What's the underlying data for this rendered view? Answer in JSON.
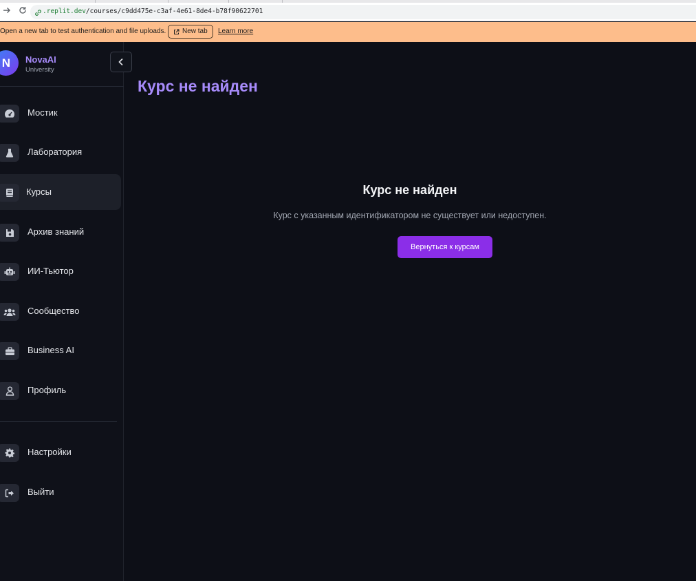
{
  "browser": {
    "url_host": ".replit.dev",
    "url_path": "/courses/c9dd475e-c3af-4e61-8de4-b78f90622701"
  },
  "banner": {
    "message": "Open a new tab to test authentication and file uploads.",
    "new_tab_label": "New tab",
    "learn_more_label": "Learn more"
  },
  "brand": {
    "initial": "N",
    "name": "NovaAI",
    "subtitle": "University"
  },
  "sidebar": {
    "items": [
      {
        "label": "Мостик",
        "icon": "dashboard-gauge-icon"
      },
      {
        "label": "Лаборатория",
        "icon": "flask-icon"
      },
      {
        "label": "Курсы",
        "icon": "book-icon",
        "active": true
      },
      {
        "label": "Архив знаний",
        "icon": "floppy-disk-icon"
      },
      {
        "label": "ИИ-Тьютор",
        "icon": "robot-icon"
      },
      {
        "label": "Сообщество",
        "icon": "users-icon"
      },
      {
        "label": "Business AI",
        "icon": "briefcase-icon"
      },
      {
        "label": "Профиль",
        "icon": "user-icon"
      }
    ],
    "bottom_items": [
      {
        "label": "Настройки",
        "icon": "gear-icon"
      },
      {
        "label": "Выйти",
        "icon": "sign-out-icon"
      }
    ]
  },
  "main": {
    "page_title": "Курс не найден",
    "not_found_title": "Курс не найден",
    "not_found_description": "Курс с указанным идентификатором не существует или недоступен.",
    "back_button_label": "Вернуться к курсам"
  },
  "colors": {
    "accent_purple": "#a78bfa",
    "button_purple": "#8b2ee8",
    "background": "#0d0f17",
    "banner": "#fdbd8b"
  }
}
